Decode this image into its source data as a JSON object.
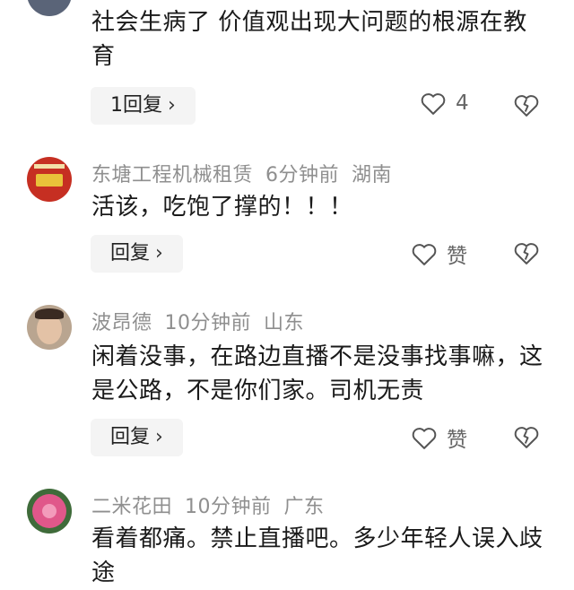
{
  "comments": [
    {
      "text": "社会生病了 价值观出现大问题的根源在教育",
      "reply_label": "1回复",
      "like_label": "4"
    },
    {
      "user": "东塘工程机械租赁",
      "time": "6分钟前",
      "location": "湖南",
      "text": "活该，吃饱了撑的！！！",
      "reply_label": "回复",
      "like_label": "赞"
    },
    {
      "user": "波昂德",
      "time": "10分钟前",
      "location": "山东",
      "text": "闲着没事，在路边直播不是没事找事嘛，这是公路，不是你们家。司机无责",
      "reply_label": "回复",
      "like_label": "赞"
    },
    {
      "user": "二米花田",
      "time": "10分钟前",
      "location": "广东",
      "text": "看着都痛。禁止直播吧。多少年轻人误入歧途"
    }
  ],
  "icons": {
    "like": "heart-icon",
    "dislike": "broken-heart-icon",
    "chevron": "chevron-right-icon"
  }
}
